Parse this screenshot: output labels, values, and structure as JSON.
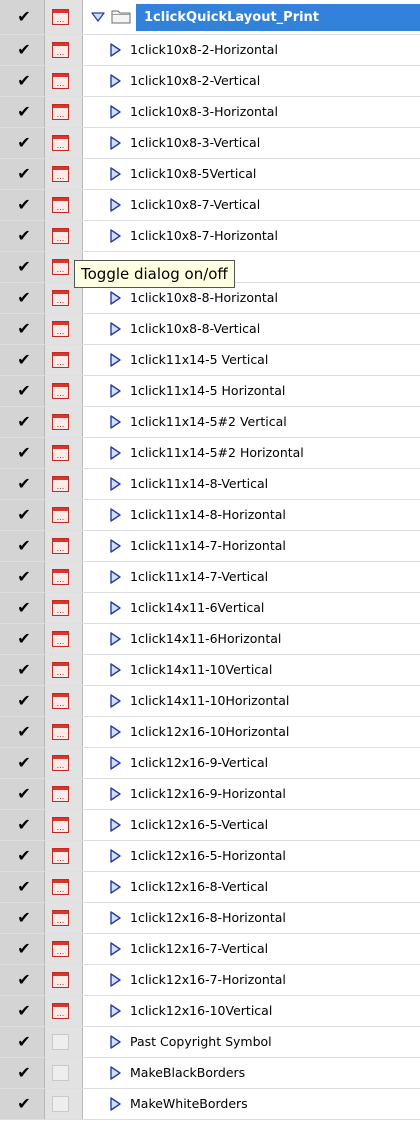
{
  "action_set": {
    "name": "1clickQuickLayout_Print",
    "enabled": true,
    "expanded": true,
    "icon": "folder-icon"
  },
  "tooltip": {
    "text": "Toggle dialog on/off"
  },
  "actions": [
    {
      "name": "1click10x8-2-Horizontal",
      "enabled": true,
      "dialog": true
    },
    {
      "name": "1click10x8-2-Vertical",
      "enabled": true,
      "dialog": true
    },
    {
      "name": "1click10x8-3-Horizontal",
      "enabled": true,
      "dialog": true
    },
    {
      "name": "1click10x8-3-Vertical",
      "enabled": true,
      "dialog": true
    },
    {
      "name": "1click10x8-5Vertical",
      "enabled": true,
      "dialog": true
    },
    {
      "name": "1click10x8-7-Vertical",
      "enabled": true,
      "dialog": true
    },
    {
      "name": "1click10x8-7-Horizontal",
      "enabled": true,
      "dialog": true
    },
    {
      "name": "ntal",
      "enabled": true,
      "dialog": true
    },
    {
      "name": "1click10x8-8-Horizontal",
      "enabled": true,
      "dialog": true
    },
    {
      "name": "1click10x8-8-Vertical",
      "enabled": true,
      "dialog": true
    },
    {
      "name": "1click11x14-5 Vertical",
      "enabled": true,
      "dialog": true
    },
    {
      "name": "1click11x14-5 Horizontal",
      "enabled": true,
      "dialog": true
    },
    {
      "name": "1click11x14-5#2 Vertical",
      "enabled": true,
      "dialog": true
    },
    {
      "name": "1click11x14-5#2 Horizontal",
      "enabled": true,
      "dialog": true
    },
    {
      "name": "1click11x14-8-Vertical",
      "enabled": true,
      "dialog": true
    },
    {
      "name": "1click11x14-8-Horizontal",
      "enabled": true,
      "dialog": true
    },
    {
      "name": "1click11x14-7-Horizontal",
      "enabled": true,
      "dialog": true
    },
    {
      "name": "1click11x14-7-Vertical",
      "enabled": true,
      "dialog": true
    },
    {
      "name": "1click14x11-6Vertical",
      "enabled": true,
      "dialog": true
    },
    {
      "name": "1click14x11-6Horizontal",
      "enabled": true,
      "dialog": true
    },
    {
      "name": "1click14x11-10Vertical",
      "enabled": true,
      "dialog": true
    },
    {
      "name": "1click14x11-10Horizontal",
      "enabled": true,
      "dialog": true
    },
    {
      "name": "1click12x16-10Horizontal",
      "enabled": true,
      "dialog": true
    },
    {
      "name": "1click12x16-9-Vertical",
      "enabled": true,
      "dialog": true
    },
    {
      "name": "1click12x16-9-Horizontal",
      "enabled": true,
      "dialog": true
    },
    {
      "name": "1click12x16-5-Vertical",
      "enabled": true,
      "dialog": true
    },
    {
      "name": "1click12x16-5-Horizontal",
      "enabled": true,
      "dialog": true
    },
    {
      "name": "1click12x16-8-Vertical",
      "enabled": true,
      "dialog": true
    },
    {
      "name": "1click12x16-8-Horizontal",
      "enabled": true,
      "dialog": true
    },
    {
      "name": "1click12x16-7-Vertical",
      "enabled": true,
      "dialog": true
    },
    {
      "name": "1click12x16-7-Horizontal",
      "enabled": true,
      "dialog": true
    },
    {
      "name": "1click12x16-10Vertical",
      "enabled": true,
      "dialog": true
    },
    {
      "name": "Past Copyright Symbol",
      "enabled": true,
      "dialog": false
    },
    {
      "name": "MakeBlackBorders",
      "enabled": true,
      "dialog": false
    },
    {
      "name": "MakeWhiteBorders",
      "enabled": true,
      "dialog": false
    }
  ],
  "colors": {
    "selection": "#3282dc",
    "dialog_icon": "#d9362b",
    "expand_triangle": "#2a3c9e"
  }
}
